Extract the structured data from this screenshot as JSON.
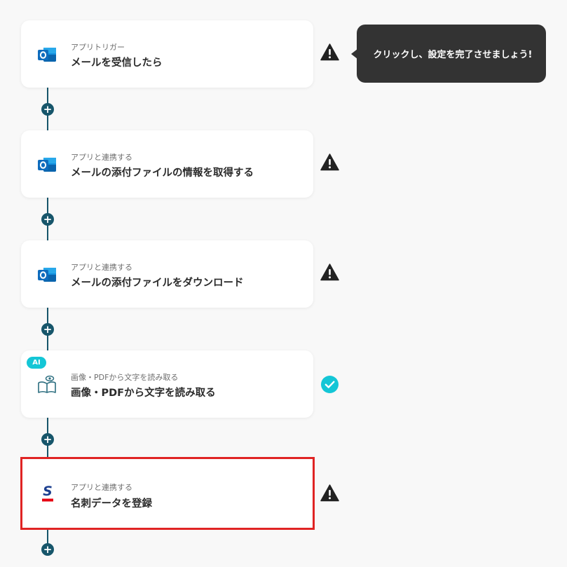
{
  "colors": {
    "accent": "#17566b",
    "selected_border": "#e02424",
    "warning": "#222222",
    "success": "#14c6d6",
    "tooltip_bg": "#333333"
  },
  "steps": [
    {
      "subtitle": "アプリトリガー",
      "title": "メールを受信したら",
      "icon": "outlook-icon",
      "status": "warning-icon"
    },
    {
      "subtitle": "アプリと連携する",
      "title": "メールの添付ファイルの情報を取得する",
      "icon": "outlook-icon",
      "status": "warning-icon"
    },
    {
      "subtitle": "アプリと連携する",
      "title": "メールの添付ファイルをダウンロード",
      "icon": "outlook-icon",
      "status": "warning-icon"
    },
    {
      "subtitle": "画像・PDFから文字を読み取る",
      "title": "画像・PDFから文字を読み取る",
      "icon": "ocr-book-icon",
      "status": "check-circle-icon",
      "badge": "AI"
    },
    {
      "subtitle": "アプリと連携する",
      "title": "名刺データを登録",
      "icon": "sansan-icon",
      "status": "warning-icon",
      "selected": true
    }
  ],
  "add_step_symbol": "+",
  "tooltip": {
    "text": "クリックし、設定を完了させましょう!"
  }
}
